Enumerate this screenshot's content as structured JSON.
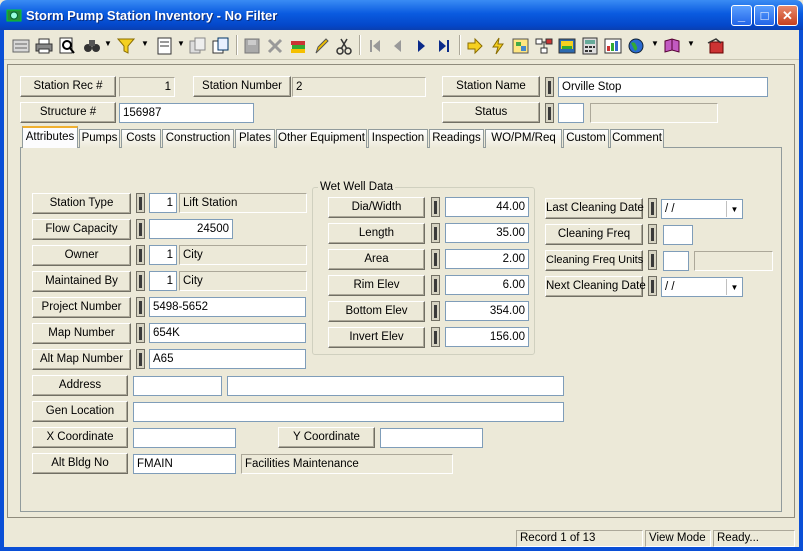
{
  "window": {
    "title": "Storm Pump Station Inventory - No Filter"
  },
  "header": {
    "station_rec_label": "Station Rec #",
    "station_rec_value": "1",
    "station_number_label": "Station Number",
    "station_number_value": "2",
    "station_name_label": "Station Name",
    "station_name_value": "Orville Stop",
    "structure_label": "Structure #",
    "structure_value": "156987",
    "status_label": "Status",
    "status_code": "",
    "status_desc": ""
  },
  "tabs": [
    "Attributes",
    "Pumps",
    "Costs",
    "Construction",
    "Plates",
    "Other Equipment",
    "Inspection",
    "Readings",
    "WO/PM/Req",
    "Custom",
    "Comment"
  ],
  "active_tab": "Attributes",
  "attributes": {
    "station_type_label": "Station Type",
    "station_type_code": "1",
    "station_type_desc": "Lift Station",
    "flow_capacity_label": "Flow Capacity",
    "flow_capacity_value": "24500",
    "owner_label": "Owner",
    "owner_code": "1",
    "owner_desc": "City",
    "maintained_by_label": "Maintained By",
    "maintained_by_code": "1",
    "maintained_by_desc": "City",
    "project_number_label": "Project Number",
    "project_number_value": "5498-5652",
    "map_number_label": "Map Number",
    "map_number_value": "654K",
    "alt_map_number_label": "Alt Map Number",
    "alt_map_number_value": "A65",
    "address_label": "Address",
    "address_number": "",
    "address_street": "",
    "gen_location_label": "Gen Location",
    "gen_location_value": "",
    "x_coordinate_label": "X Coordinate",
    "x_coordinate_value": "",
    "y_coordinate_label": "Y Coordinate",
    "y_coordinate_value": "",
    "alt_bldg_no_label": "Alt Bldg No",
    "alt_bldg_no_value": "FMAIN",
    "alt_bldg_no_desc": "Facilities Maintenance"
  },
  "wet_well": {
    "title": "Wet Well Data",
    "dia_width_label": "Dia/Width",
    "dia_width_value": "44.00",
    "length_label": "Length",
    "length_value": "35.00",
    "area_label": "Area",
    "area_value": "2.00",
    "rim_elev_label": "Rim Elev",
    "rim_elev_value": "6.00",
    "bottom_elev_label": "Bottom Elev",
    "bottom_elev_value": "354.00",
    "invert_elev_label": "Invert Elev",
    "invert_elev_value": "156.00"
  },
  "cleaning": {
    "last_cleaning_label": "Last Cleaning Date",
    "last_cleaning_value": " /  /",
    "cleaning_freq_label": "Cleaning Freq",
    "cleaning_freq_value": "",
    "cleaning_freq_units_label": "Cleaning Freq Units",
    "cleaning_freq_units_code": "",
    "cleaning_freq_units_desc": "",
    "next_cleaning_label": "Next Cleaning Date",
    "next_cleaning_value": " /  /"
  },
  "status_bar": {
    "record": "Record 1 of 13",
    "mode": "View Mode",
    "state": "Ready..."
  },
  "icons": [
    "app-icon",
    "list-icon",
    "print-icon",
    "print-preview-icon",
    "binoculars-icon",
    "filter-icon",
    "form-view-icon",
    "copy-record-icon",
    "new-record-icon",
    "save-icon",
    "delete-icon",
    "books-icon",
    "pencil-icon",
    "scissors-icon",
    "first-record-icon",
    "previous-record-icon",
    "next-record-icon",
    "last-record-icon",
    "arrow-right-icon",
    "lightning-icon",
    "map-icon",
    "tree-icon",
    "image-icon",
    "calculator-icon",
    "chart-icon",
    "globe-icon",
    "book-icon",
    "exit-icon"
  ],
  "colors": {
    "title_bar": "#0a5be0",
    "window_bg": "#ece9d8",
    "active_tab_accent": "#f0b030"
  }
}
